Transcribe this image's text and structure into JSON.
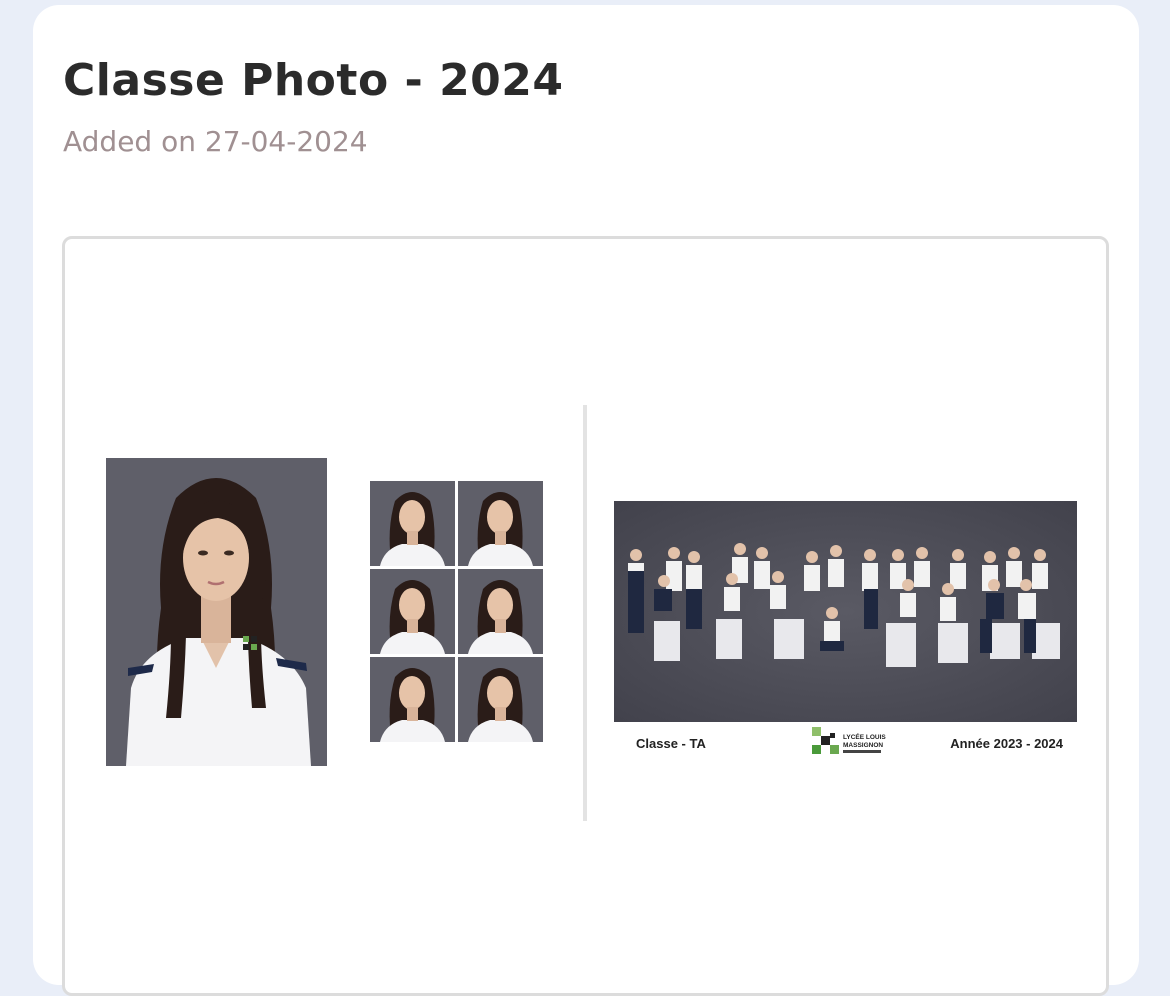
{
  "header": {
    "title": "Classe Photo - 2024",
    "added_on": "Added on 27-04-2024"
  },
  "photos": {
    "portrait_icon": "portrait-photo",
    "id_photos_count_visible": 6,
    "group": {
      "class_label": "Classe - TA",
      "year_label": "Année 2023 - 2024",
      "school_logo_text": "LYCÉE LOUIS MASSIGNON"
    }
  },
  "colors": {
    "page_bg": "#e9eef8",
    "card_bg": "#ffffff",
    "title": "#2b2b2b",
    "subtitle": "#a09092",
    "photo_bg": "#5f5f69"
  }
}
